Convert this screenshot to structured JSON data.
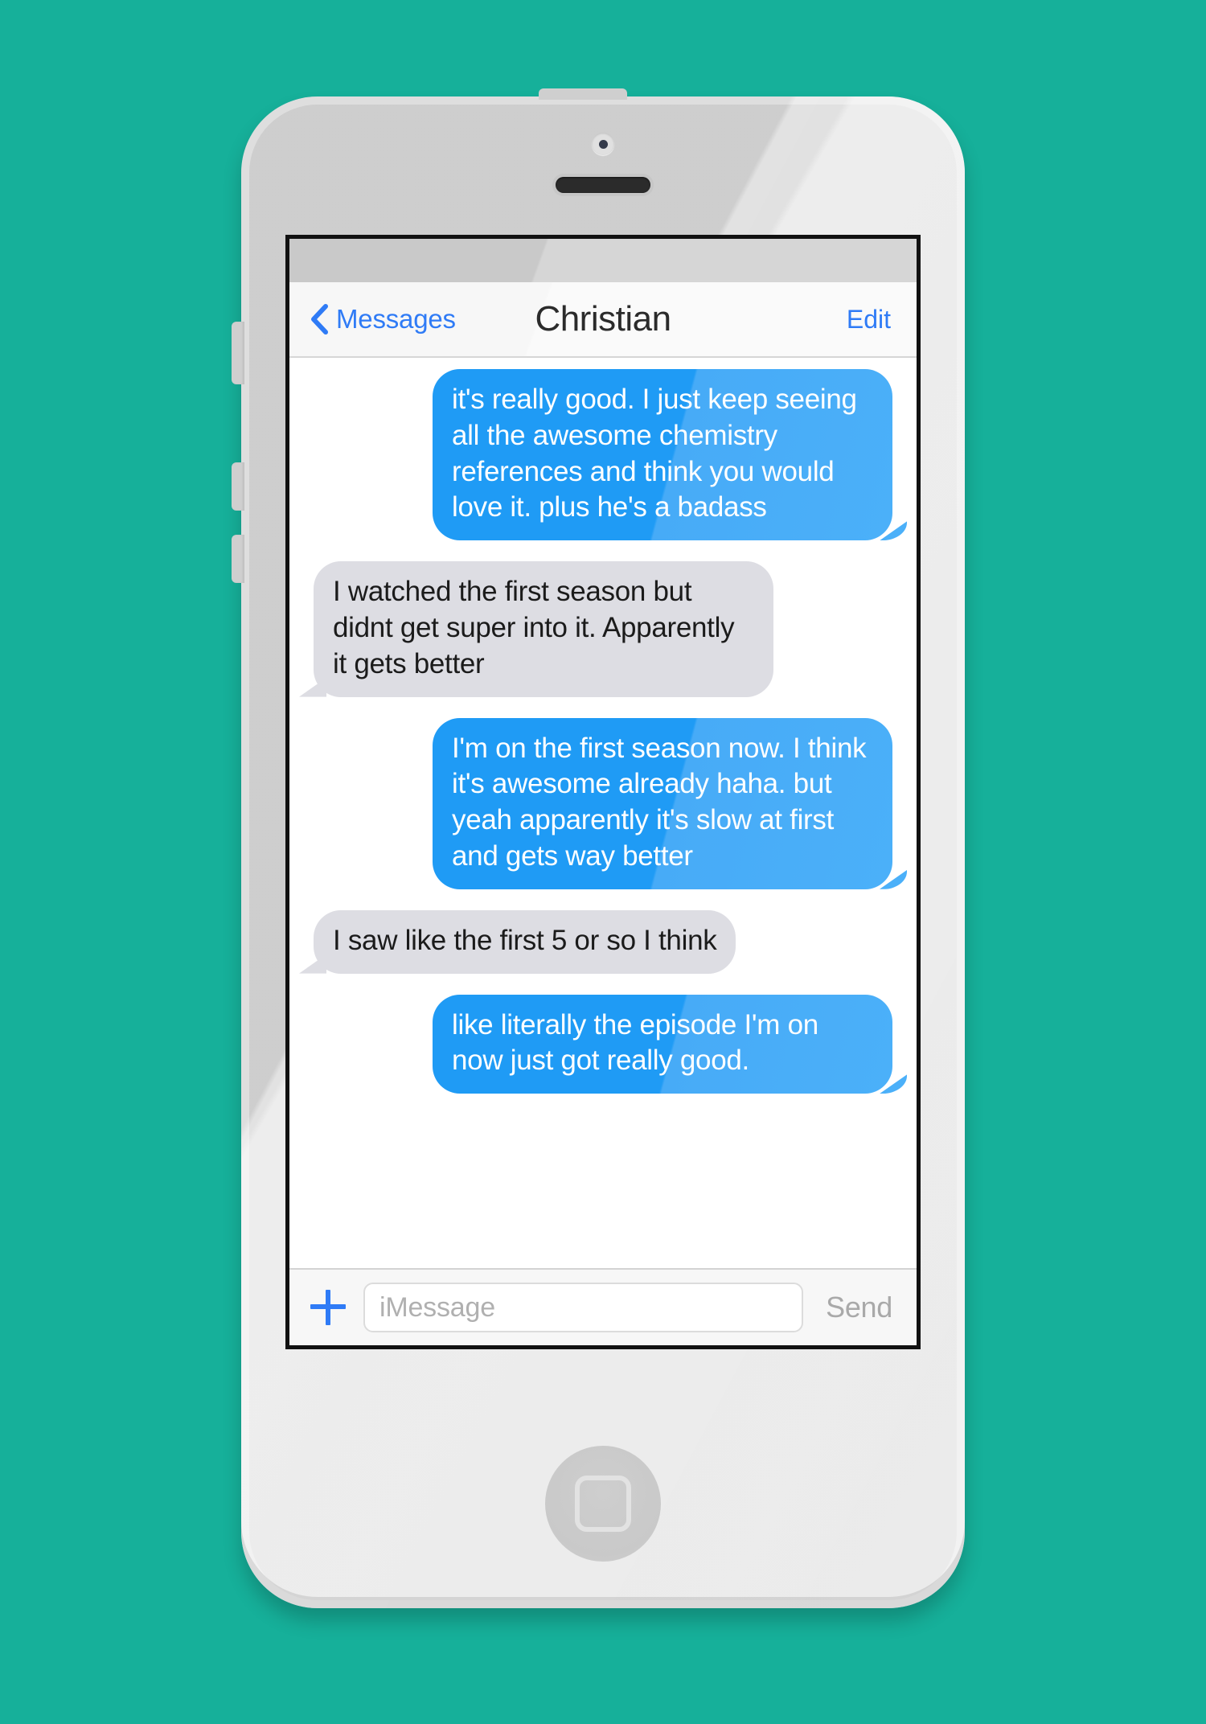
{
  "theme": {
    "background_color": "#16b09a",
    "accent_blue": "#2f7bf6",
    "bubble_out_color": "#1f9bf5",
    "bubble_in_color": "#dddde3",
    "send_disabled_color": "#a9a9a9"
  },
  "device": {
    "name": "white-smartphone",
    "camera": "front-camera",
    "speaker": "earpiece-speaker",
    "home_button": "home-button",
    "side_buttons": [
      "mute-switch",
      "volume-up-button",
      "volume-down-button",
      "power-button"
    ]
  },
  "nav": {
    "back_icon": "chevron-left-icon",
    "back_label": "Messages",
    "title": "Christian",
    "edit_label": "Edit"
  },
  "conversation": {
    "messages": [
      {
        "side": "out",
        "text": "it's really good. I just keep seeing all the awesome chemistry references and think you would love it. plus he's a badass"
      },
      {
        "side": "in",
        "text": "I watched the first season but didnt get super into it. Apparently it gets better"
      },
      {
        "side": "out",
        "text": "I'm on the first season now. I think it's awesome already haha. but yeah apparently it's slow at first and gets way better"
      },
      {
        "side": "in",
        "text": "I saw like the first 5 or so I think"
      },
      {
        "side": "out",
        "text": "like literally the episode I'm on now just got really good."
      }
    ]
  },
  "input_bar": {
    "add_icon": "plus-icon",
    "placeholder": "iMessage",
    "value": "",
    "send_label": "Send"
  }
}
